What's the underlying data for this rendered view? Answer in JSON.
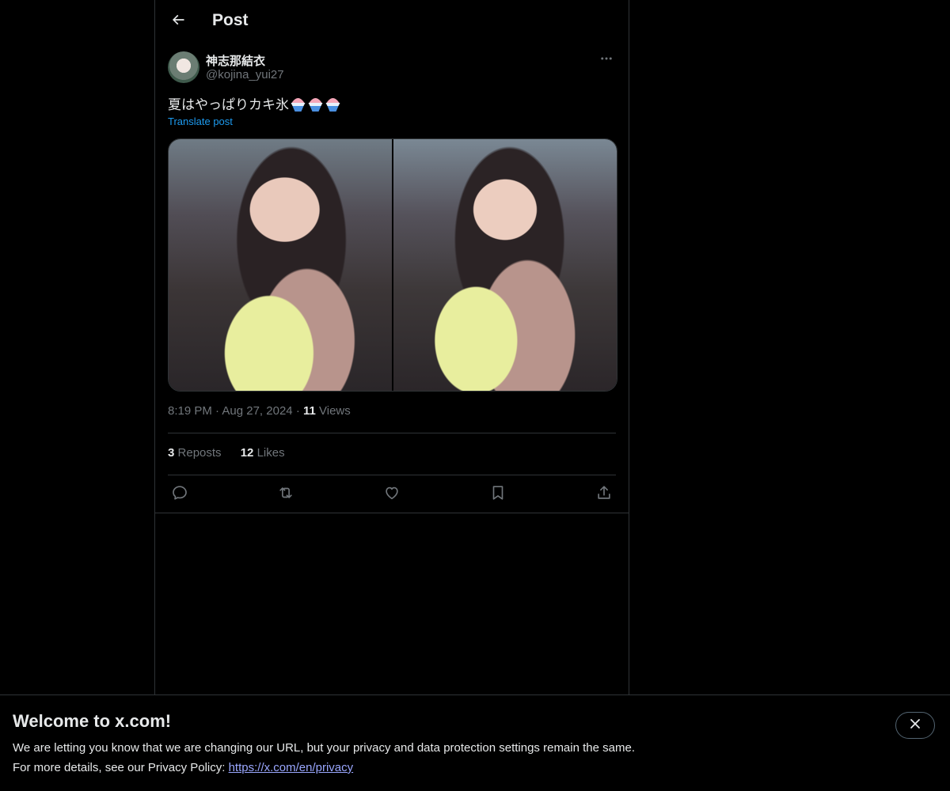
{
  "header": {
    "title": "Post",
    "back_icon": "arrow-left-icon"
  },
  "post": {
    "author_name": "神志那結衣",
    "author_handle": "@kojina_yui27",
    "text": "夏はやっぱりカキ氷",
    "emoji_icon": "shaved-ice-icon",
    "emoji_count": 3,
    "translate_label": "Translate post",
    "time": "8:19 PM",
    "date": "Aug 27, 2024",
    "separator": "·",
    "views_count": "11",
    "views_label": "Views",
    "reposts_count": "3",
    "reposts_label": "Reposts",
    "likes_count": "12",
    "likes_label": "Likes",
    "media": [
      {
        "type": "photo"
      },
      {
        "type": "photo"
      }
    ]
  },
  "actions": [
    "reply-icon",
    "repost-icon",
    "like-icon",
    "bookmark-icon",
    "share-icon"
  ],
  "banner": {
    "title": "Welcome to x.com!",
    "line1": "We are letting you know that we are changing our URL, but your privacy and data protection settings remain the same.",
    "line2_prefix": "For more details, see our Privacy Policy: ",
    "link": "https://x.com/en/privacy"
  },
  "colors": {
    "background": "#000000",
    "text_primary": "#e7e9ea",
    "text_secondary": "#71767b",
    "accent": "#1d9bf0",
    "border": "#2f3336"
  }
}
